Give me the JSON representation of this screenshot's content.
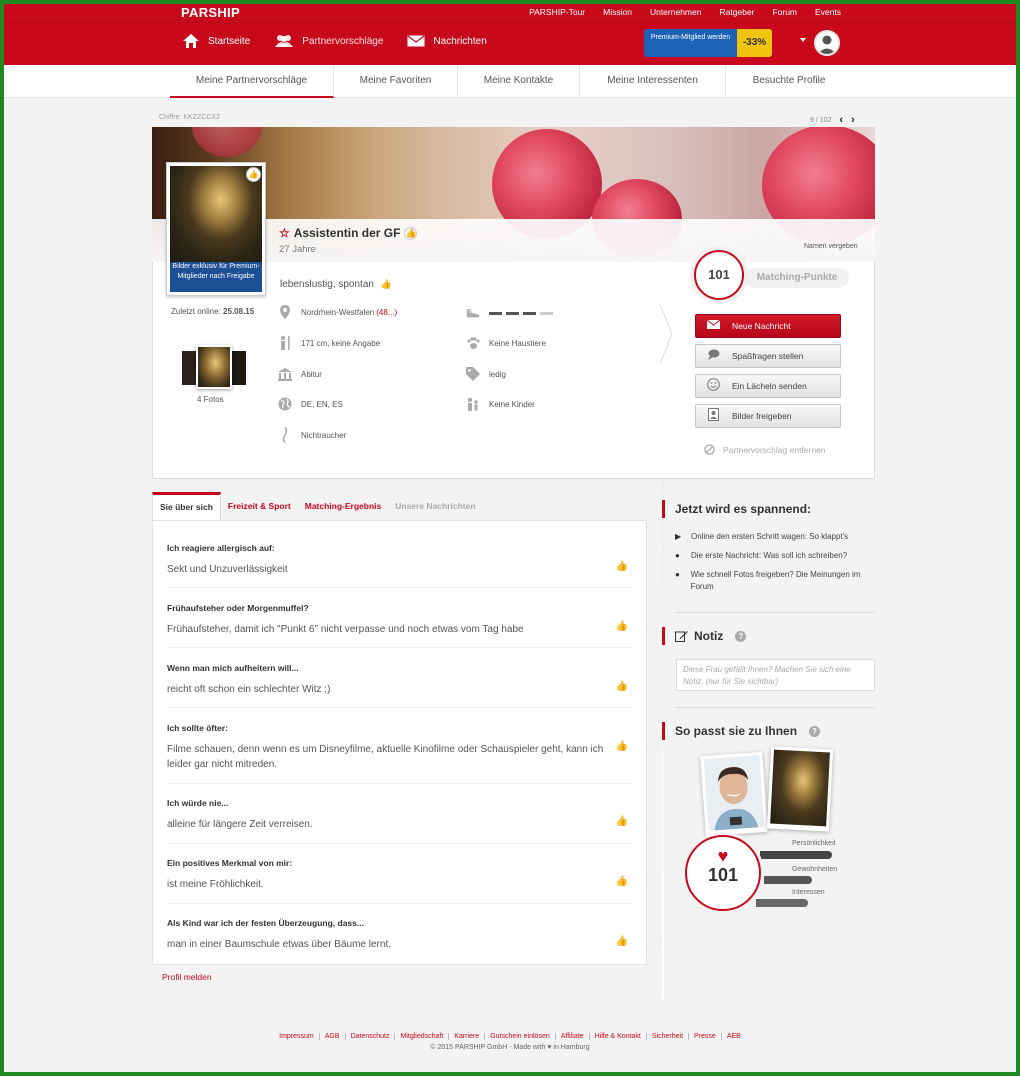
{
  "header": {
    "logo": "PARSHIP",
    "top_links": [
      "PARSHIP-Tour",
      "Mission",
      "Unternehmen",
      "Ratgeber",
      "Forum",
      "Events"
    ],
    "nav": [
      {
        "label": "Startseite",
        "icon": "home-icon"
      },
      {
        "label": "Partnervorschläge",
        "icon": "people-icon"
      },
      {
        "label": "Nachrichten",
        "icon": "envelope-icon"
      }
    ],
    "premium_label": "Premium-Mitglied werden",
    "premium_discount": "-33%"
  },
  "subnav": {
    "tabs": [
      "Meine Partnervorschläge",
      "Meine Favoriten",
      "Meine Kontakte",
      "Meine Interessenten",
      "Besuchte Profile"
    ],
    "active_index": 0
  },
  "profile": {
    "chiffre": "Chiffre: KKZZCCX2",
    "pager": "9 / 102",
    "photo_caption": "Bilder exklusiv für Premium-Mitglieder nach Freigabe",
    "title": "Assistentin der GF",
    "age": "27 Jahre",
    "name_action": "Namen vergeben",
    "last_online_label": "Zuletzt online:",
    "last_online_date": "25.08.15",
    "photos_count": "4 Fotos",
    "tagline": "lebenslustig, spontan",
    "attributes_left": [
      {
        "icon": "location-pin-icon",
        "text": "Nordrhein-Westfalen",
        "extra": "(48...)"
      },
      {
        "icon": "person-height-icon",
        "text": "171 cm, keine Angabe"
      },
      {
        "icon": "education-building-icon",
        "text": "Abitur"
      },
      {
        "icon": "globe-icon",
        "text": "DE, EN, ES"
      },
      {
        "icon": "smoke-icon",
        "text": "Nichtraucher"
      }
    ],
    "attributes_right": [
      {
        "icon": "shoe-icon",
        "text": ""
      },
      {
        "icon": "paw-icon",
        "text": "Keine Haustiere"
      },
      {
        "icon": "tag-icon",
        "text": "ledig"
      },
      {
        "icon": "children-icon",
        "text": "Keine Kinder"
      }
    ]
  },
  "actions": {
    "score": "101",
    "score_label": "Matching-Punkte",
    "buttons": [
      {
        "label": "Neue Nachricht",
        "icon": "envelope-icon"
      },
      {
        "label": "Spaßfragen stellen",
        "icon": "speech-bubble-icon"
      },
      {
        "label": "Ein Lächeln senden",
        "icon": "smile-icon"
      },
      {
        "label": "Bilder freigeben",
        "icon": "image-icon"
      }
    ],
    "remove_label": "Partnervorschlag entfernen"
  },
  "tabs": {
    "items": [
      "Sie über sich",
      "Freizeit & Sport",
      "Matching-Ergebnis",
      "Unsere Nachrichten"
    ],
    "active_index": 0
  },
  "qa": [
    {
      "q": "Ich reagiere allergisch auf:",
      "a": "Sekt und Unzuverlässigkeit"
    },
    {
      "q": "Frühaufsteher oder Morgenmuffel?",
      "a": "Frühaufsteher, damit ich \"Punkt 6\" nicht verpasse und noch etwas vom Tag habe"
    },
    {
      "q": "Wenn man mich aufheitern will...",
      "a": "reicht oft schon ein schlechter Witz ;)"
    },
    {
      "q": "Ich sollte öfter:",
      "a": "Filme schauen, denn wenn es um Disneyfilme, aktuelle Kinofilme oder Schauspieler geht, kann ich leider gar nicht mitreden."
    },
    {
      "q": "Ich würde nie...",
      "a": "alleine für längere Zeit verreisen."
    },
    {
      "q": "Ein positives Merkmal von mir:",
      "a": "ist meine Fröhlichkeit."
    },
    {
      "q": "Als Kind war ich der festen Überzeugung, dass...",
      "a": "man in einer Baumschule etwas über Bäume lernt."
    }
  ],
  "report_label": "Profil melden",
  "sidebar": {
    "spannend_title": "Jetzt wird es spannend:",
    "spannend_items": [
      {
        "icon": "play-icon",
        "text": "Online den ersten Schritt wagen: So klappt's"
      },
      {
        "icon": "chat-icon",
        "text": "Die erste Nachricht: Was soll ich schreiben?"
      },
      {
        "icon": "comments-icon",
        "text": "Wie schnell Fotos freigeben? Die Meinungen im Forum"
      }
    ],
    "notiz_title": "Notiz",
    "notiz_placeholder": "Diese Frau gefällt Ihnen? Machen Sie sich eine Notiz. (nur für Sie sichtbar)",
    "passt_title": "So passt sie zu Ihnen",
    "match_score": "101",
    "match_bars": [
      {
        "label": "Persönlichkeit",
        "value": 0.9
      },
      {
        "label": "Gewohnheiten",
        "value": 0.6
      },
      {
        "label": "Interessen",
        "value": 0.65
      }
    ]
  },
  "footer": {
    "links": [
      "Impressum",
      "AGB",
      "Datenschutz",
      "Mitgliedschaft",
      "Karriere",
      "Gutschein einlösen",
      "Affiliate",
      "Hilfe & Kontakt",
      "Sicherheit",
      "Presse",
      "AEB"
    ],
    "copyright": "© 2015 PARSHIP GmbH - Made with ♥ in Hamburg"
  },
  "colors": {
    "brand": "#c8091c",
    "premium_blue": "#1e62b6",
    "premium_yellow": "#f1c40f"
  }
}
